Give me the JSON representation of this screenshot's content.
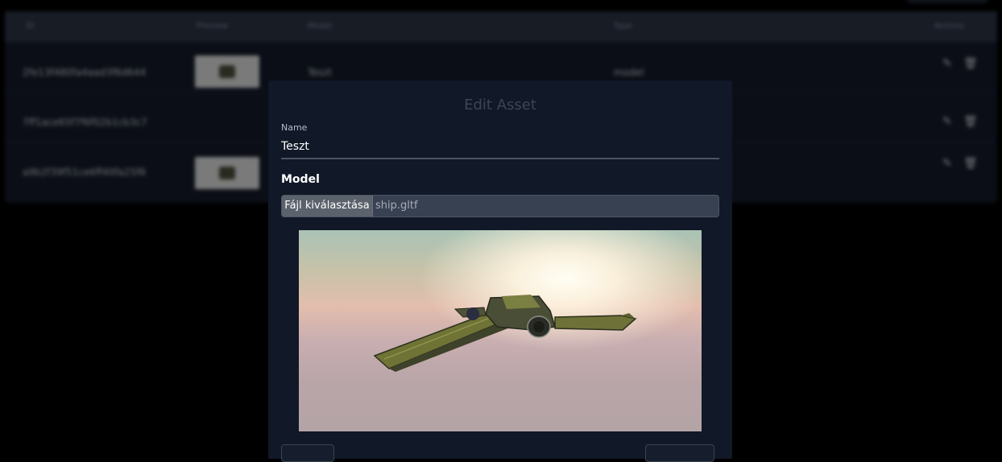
{
  "table": {
    "headers": [
      "ID",
      "Preview",
      "Model",
      "Type",
      "Actions"
    ],
    "rows": [
      {
        "id": "2fe13f480fa4aad3f6d644",
        "model": "Teszt",
        "type": "model",
        "has_thumb": true
      },
      {
        "id": "7ff1ace65f7f6f02b1cb3c7",
        "model": "",
        "type": "",
        "has_thumb": false
      },
      {
        "id": "a9b2f39f51ce6ff40fa25f6",
        "model": "",
        "type": "",
        "has_thumb": true
      }
    ]
  },
  "modal": {
    "title": "Edit Asset",
    "name_label": "Name",
    "name_value": "Teszt",
    "model_heading": "Model",
    "file_button_label": "Fájl kiválasztása",
    "file_name": "ship.gltf"
  },
  "icons": {
    "edit": "edit-icon",
    "delete": "trash-icon"
  },
  "colors": {
    "modal_bg": "#111827",
    "input_bg": "#374151",
    "page_bg": "#000000"
  }
}
